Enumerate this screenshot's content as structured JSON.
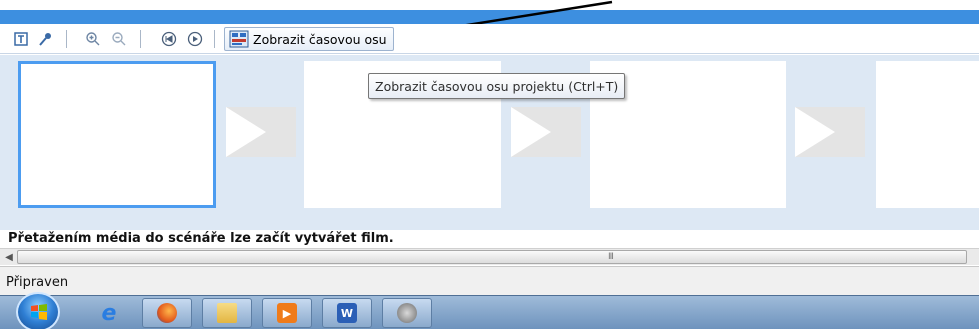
{
  "toolbar": {
    "timeline_label": "Zobrazit časovou osu"
  },
  "tooltip": {
    "text": "Zobrazit časovou osu projektu (Ctrl+T)"
  },
  "storyboard": {
    "hint": "Přetažením média do scénáře lze začít vytvářet film."
  },
  "status": {
    "text": "Připraven"
  },
  "scrollbar": {
    "grip": "III"
  },
  "taskbar": {
    "apps": [
      "internet-explorer",
      "firefox",
      "windows-explorer",
      "media-player",
      "word",
      "movie-maker"
    ],
    "word_letter": "W"
  },
  "colors": {
    "accent_blue": "#3d8fe0",
    "storyboard_bg": "#dde8f4",
    "selected_border": "#4c9cf0"
  }
}
